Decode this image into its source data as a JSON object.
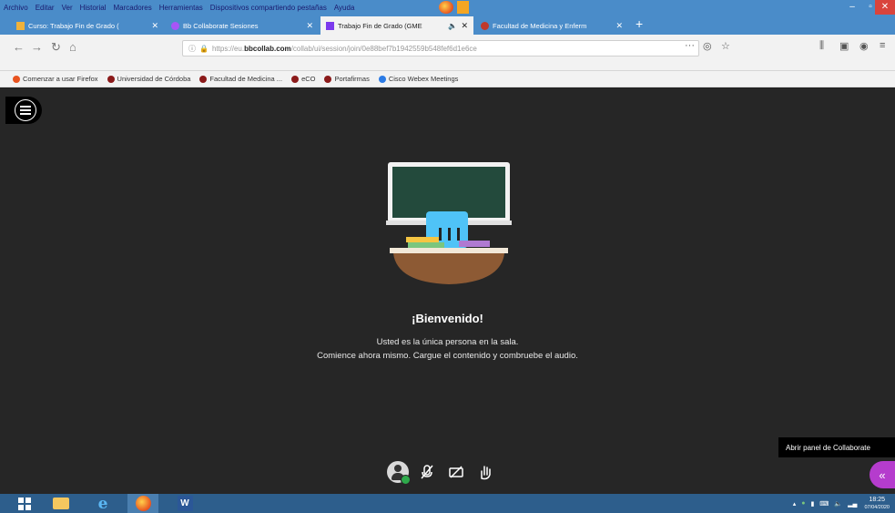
{
  "menubar": {
    "items": [
      "Archivo",
      "Editar",
      "Ver",
      "Historial",
      "Marcadores",
      "Herramientas",
      "Dispositivos compartiendo pestañas",
      "Ayuda"
    ]
  },
  "tabs": [
    {
      "label": "Curso: Trabajo Fin de Grado (",
      "color": "#f0b23a",
      "active": false
    },
    {
      "label": "Bb Collaborate Sesiones",
      "color": "#a855f7",
      "active": false
    },
    {
      "label": "Trabajo Fin de Grado (GME",
      "color": "#7c3aed",
      "active": true
    },
    {
      "label": "Facultad de Medicina y Enferm",
      "color": "#c0392b",
      "active": false
    }
  ],
  "url": {
    "prefix": "https://eu.",
    "host": "bbcollab.com",
    "path": "/collab/ui/session/join/0e88bef7b1942559b548fef6d1e6ce"
  },
  "bookmarks": [
    {
      "label": "Comenzar a usar Firefox",
      "color": "#e8531f"
    },
    {
      "label": "Universidad de Córdoba",
      "color": "#8b1a1a"
    },
    {
      "label": "Facultad de Medicina ...",
      "color": "#8b1a1a"
    },
    {
      "label": "eCO",
      "color": "#8b1a1a"
    },
    {
      "label": "Portafirmas",
      "color": "#8b1a1a"
    },
    {
      "label": "Cisco Webex Meetings",
      "color": "#2c7be5"
    }
  ],
  "welcome": {
    "title": "¡Bienvenido!",
    "line1": "Usted es la única persona en la sala.",
    "line2": "Comience ahora mismo. Cargue el contenido y combruebe el audio."
  },
  "tooltip": "Abrir panel de Collaborate",
  "tray": {
    "time": "18:25",
    "date": "07/04/2020"
  },
  "colors": {
    "accent": "#b53ccd",
    "background": "#262626",
    "tabbar": "#4a8cc9",
    "status_ok": "#2eaa4b"
  }
}
